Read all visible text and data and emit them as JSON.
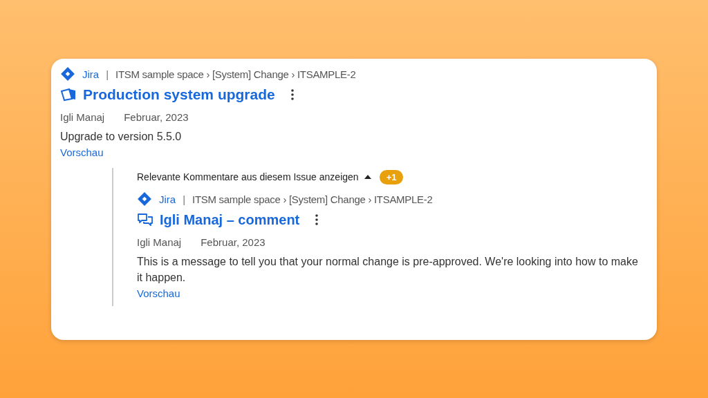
{
  "result": {
    "kind": "issue",
    "source": "Jira",
    "separator": "|",
    "path": "ITSM sample space › [System] Change › ITSAMPLE-2",
    "title": "Production system upgrade",
    "author": "Igli Manaj",
    "date": "Februar, 2023",
    "excerpt": "Upgrade to version 5.5.0",
    "preview_link": "Vorschau"
  },
  "comments_toggle": {
    "label": "Relevante Kommentare aus diesem Issue anzeigen",
    "expanded": true,
    "badge": "+1"
  },
  "comments": [
    {
      "kind": "comment",
      "source": "Jira",
      "separator": "|",
      "path": "ITSM sample space › [System] Change › ITSAMPLE-2",
      "title": "Igli Manaj – comment",
      "author": "Igli Manaj",
      "date": "Februar, 2023",
      "excerpt": "This is a message to tell you that your normal change is pre-approved. We're looking into how to make it happen.",
      "preview_link": "Vorschau"
    }
  ]
}
